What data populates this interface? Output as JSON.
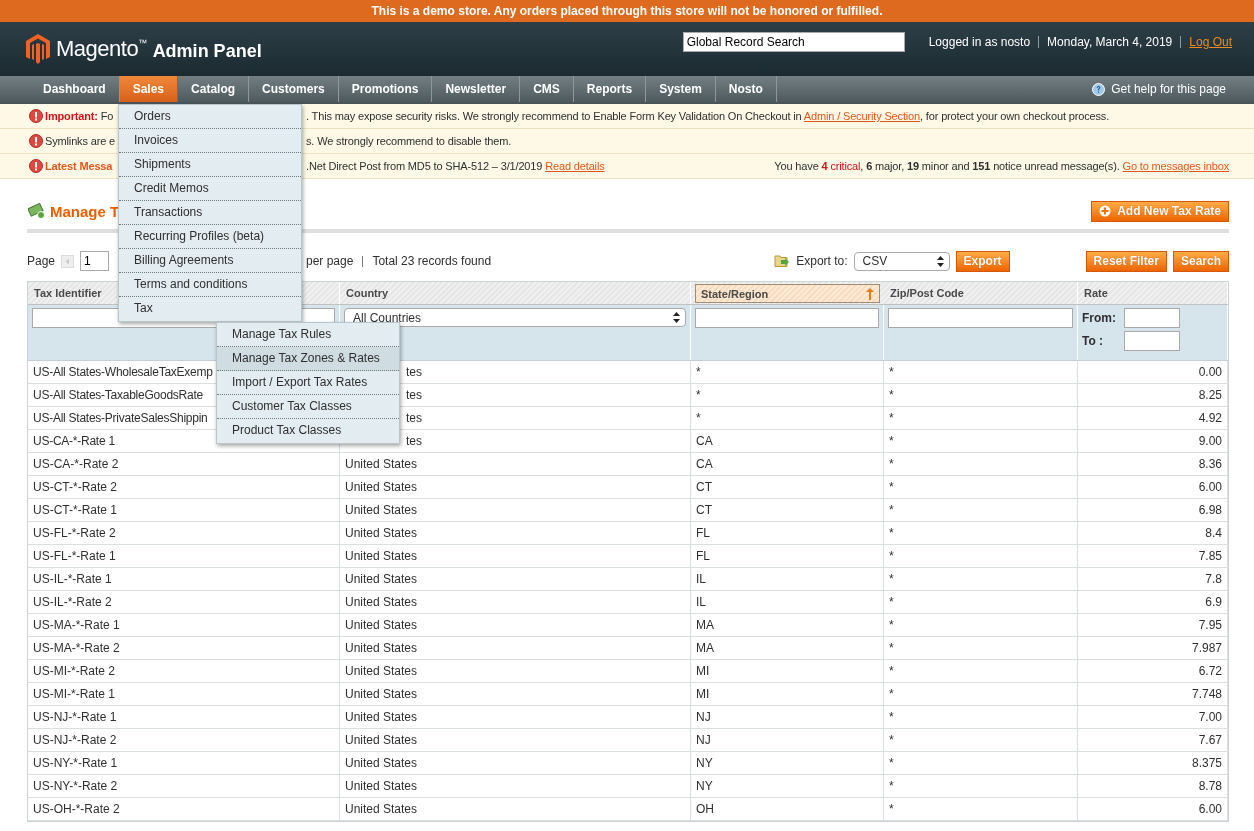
{
  "demo_notice": "This is a demo store. Any orders placed through this store will not be honored or fulfilled.",
  "header": {
    "brand": "Magento$^{™}$",
    "product": "Admin Panel",
    "search": {
      "value": "Global Record Search"
    },
    "user": "Logged in as nosto",
    "date": "Monday, March 4, 2019",
    "logout": "Log Out"
  },
  "nav": {
    "items": [
      {
        "label": "Dashboard",
        "selected": false
      },
      {
        "label": "Sales",
        "selected": true
      },
      {
        "label": "Catalog",
        "selected": false
      },
      {
        "label": "Customers",
        "selected": false
      },
      {
        "label": "Promotions",
        "selected": false
      },
      {
        "label": "Newsletter",
        "selected": false
      },
      {
        "label": "CMS",
        "selected": false
      },
      {
        "label": "Reports",
        "selected": false
      },
      {
        "label": "System",
        "selected": false
      },
      {
        "label": "Nosto",
        "selected": false
      }
    ],
    "help": "Get help for this page"
  },
  "sales_menu": {
    "items": [
      {
        "label": "Orders",
        "selected": false
      },
      {
        "label": "Invoices",
        "selected": false
      },
      {
        "label": "Shipments",
        "selected": false
      },
      {
        "label": "Credit Memos",
        "selected": false
      },
      {
        "label": "Transactions",
        "selected": false
      },
      {
        "label": "Recurring Profiles (beta)",
        "selected": false
      },
      {
        "label": "Billing Agreements",
        "selected": false
      },
      {
        "label": "Terms and conditions",
        "selected": false
      },
      {
        "label": "Tax",
        "selected": false
      }
    ]
  },
  "tax_menu": {
    "items": [
      {
        "label": "Manage Tax Rules",
        "selected": false
      },
      {
        "label": "Manage Tax Zones & Rates",
        "selected": true
      },
      {
        "label": "Import / Export Tax Rates",
        "selected": false
      },
      {
        "label": "Customer Tax Classes",
        "selected": false
      },
      {
        "label": "Product Tax Classes",
        "selected": false
      }
    ]
  },
  "notices": [
    {
      "kind": "important",
      "lead": "Important:",
      "left": " Fo",
      "before": ". This may expose security risks. We strongly recommend to Enable Form Key Validation On Checkout in ",
      "link": "Admin / Security Section",
      "after": ", for protect your own checkout process."
    },
    {
      "kind": "plain",
      "left": "Symlinks are e",
      "before": "s. We strongly recommend to disable them."
    },
    {
      "kind": "latest",
      "lead": "Latest Messa",
      "before": ".Net Direct Post from MD5 to SHA-512 – 3/1/2019 ",
      "link": "Read details",
      "summary": [
        {
          "kind": "text",
          "text": "You have "
        },
        {
          "kind": "critical_count",
          "text": "4"
        },
        {
          "kind": "critical",
          "text": " critical"
        },
        {
          "kind": "text",
          "text": ", "
        },
        {
          "kind": "count",
          "text": "6"
        },
        {
          "kind": "text",
          "text": " major, "
        },
        {
          "kind": "count",
          "text": "19"
        },
        {
          "kind": "text",
          "text": " minor and "
        },
        {
          "kind": "count",
          "text": "151"
        },
        {
          "kind": "text",
          "text": " notice unread message(s). "
        }
      ],
      "summary_link": "Go to messages inbox"
    }
  ],
  "page_title": "Manage T",
  "add_button": "Add New Tax Rate",
  "pager": {
    "label": "Page",
    "page": "1",
    "per_page": "per page",
    "total": "Total 23 records found"
  },
  "export": {
    "label": "Export to:",
    "format": "CSV",
    "button": "Export"
  },
  "grid_buttons": [
    "Reset Filter",
    "Search"
  ],
  "table": {
    "columns": [
      {
        "label": "Tax Identifier",
        "sorted": false
      },
      {
        "label": "Country",
        "sorted": false
      },
      {
        "label": "State/Region",
        "sorted": true
      },
      {
        "label": "Zip/Post Code",
        "sorted": false
      },
      {
        "label": "Rate",
        "sorted": false
      }
    ],
    "filters": [
      {
        "kind": "text"
      },
      {
        "kind": "select",
        "value": "All Countries"
      },
      {
        "kind": "text"
      },
      {
        "kind": "text"
      },
      {
        "kind": "range",
        "from_label": "From:",
        "to_label": "To :"
      }
    ],
    "rows": [
      {
        "covered": true,
        "cells": [
          "US-All States-WholesaleTaxExemp",
          "tes",
          "*",
          "*",
          "0.00"
        ]
      },
      {
        "covered": true,
        "cells": [
          "US-All States-TaxableGoodsRate",
          "tes",
          "*",
          "*",
          "8.25"
        ]
      },
      {
        "covered": true,
        "cells": [
          "US-All States-PrivateSalesShippin",
          "tes",
          "*",
          "*",
          "4.92"
        ]
      },
      {
        "covered": true,
        "cells": [
          "US-CA-*-Rate 1",
          "tes",
          "CA",
          "*",
          "9.00"
        ]
      },
      {
        "covered": false,
        "cells": [
          "US-CA-*-Rate 2",
          "United States",
          "CA",
          "*",
          "8.36"
        ]
      },
      {
        "covered": false,
        "cells": [
          "US-CT-*-Rate 2",
          "United States",
          "CT",
          "*",
          "6.00"
        ]
      },
      {
        "covered": false,
        "cells": [
          "US-CT-*-Rate 1",
          "United States",
          "CT",
          "*",
          "6.98"
        ]
      },
      {
        "covered": false,
        "cells": [
          "US-FL-*-Rate 2",
          "United States",
          "FL",
          "*",
          "8.4"
        ]
      },
      {
        "covered": false,
        "cells": [
          "US-FL-*-Rate 1",
          "United States",
          "FL",
          "*",
          "7.85"
        ]
      },
      {
        "covered": false,
        "cells": [
          "US-IL-*-Rate 1",
          "United States",
          "IL",
          "*",
          "7.8"
        ]
      },
      {
        "covered": false,
        "cells": [
          "US-IL-*-Rate 2",
          "United States",
          "IL",
          "*",
          "6.9"
        ]
      },
      {
        "covered": false,
        "cells": [
          "US-MA-*-Rate 1",
          "United States",
          "MA",
          "*",
          "7.95"
        ]
      },
      {
        "covered": false,
        "cells": [
          "US-MA-*-Rate 2",
          "United States",
          "MA",
          "*",
          "7.987"
        ]
      },
      {
        "covered": false,
        "cells": [
          "US-MI-*-Rate 2",
          "United States",
          "MI",
          "*",
          "6.72"
        ]
      },
      {
        "covered": false,
        "cells": [
          "US-MI-*-Rate 1",
          "United States",
          "MI",
          "*",
          "7.748"
        ]
      },
      {
        "covered": false,
        "cells": [
          "US-NJ-*-Rate 1",
          "United States",
          "NJ",
          "*",
          "7.00"
        ]
      },
      {
        "covered": false,
        "cells": [
          "US-NJ-*-Rate 2",
          "United States",
          "NJ",
          "*",
          "7.67"
        ]
      },
      {
        "covered": false,
        "cells": [
          "US-NY-*-Rate 1",
          "United States",
          "NY",
          "*",
          "8.375"
        ]
      },
      {
        "covered": false,
        "cells": [
          "US-NY-*-Rate 2",
          "United States",
          "NY",
          "*",
          "8.78"
        ]
      },
      {
        "covered": false,
        "cells": [
          "US-OH-*-Rate 2",
          "United States",
          "OH",
          "*",
          "6.00"
        ]
      }
    ]
  }
}
